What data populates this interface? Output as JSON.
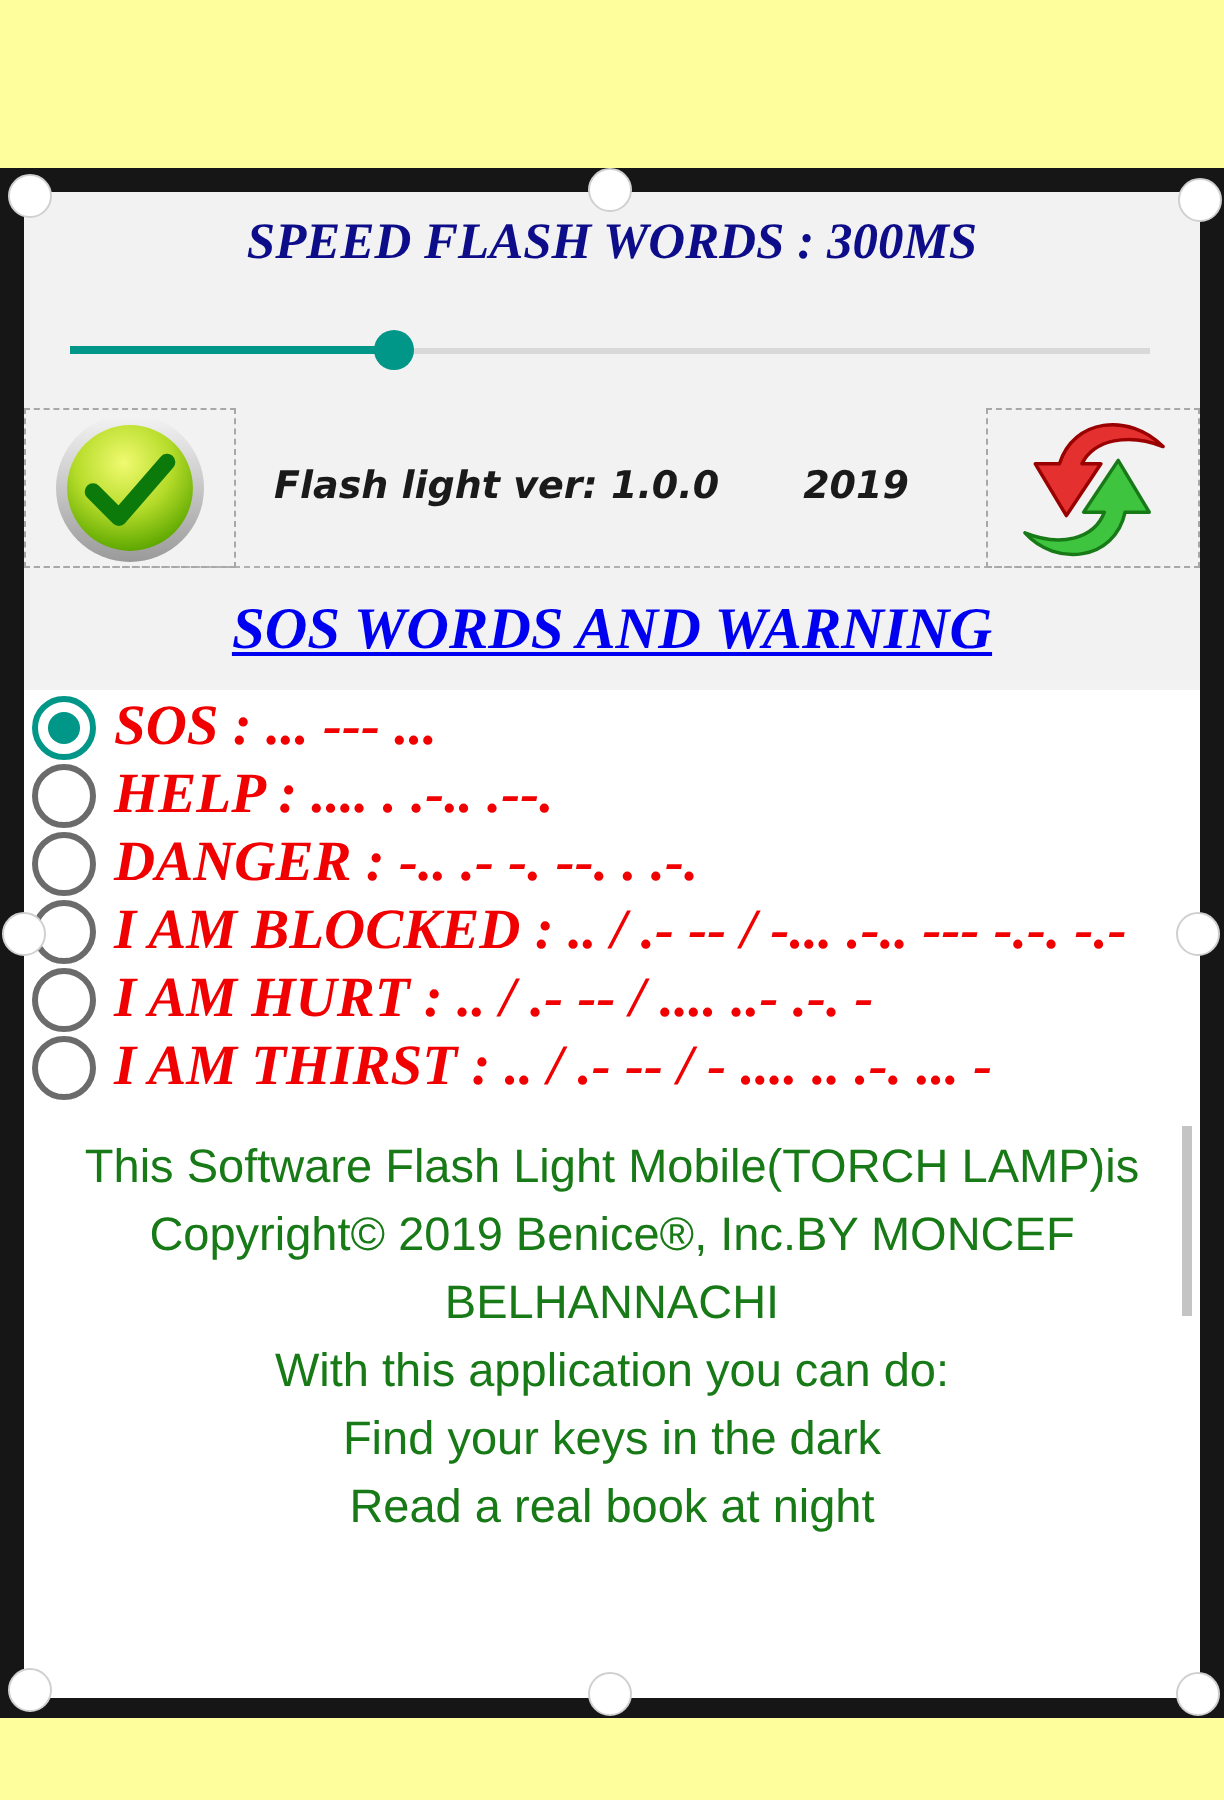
{
  "header": {
    "title": "SPEED FLASH WORDS : 300MS",
    "speed_slider": {
      "level": 0.3
    }
  },
  "info_bar": {
    "version": "Flash light ver: 1.0.0",
    "year": "2019"
  },
  "section_title": "SOS WORDS AND WARNING",
  "sos_options": [
    {
      "label": "SOS : ... --- ...",
      "selected": true
    },
    {
      "label": "HELP : .... . .-.. .--.",
      "selected": false
    },
    {
      "label": "DANGER : -.. .- -. --. . .-.",
      "selected": false
    },
    {
      "label": "I AM BLOCKED : .. / .- -- / -... .-.. --- -.-. -.-",
      "selected": false
    },
    {
      "label": "I AM HURT : .. / .- -- / .... ..- .-. -",
      "selected": false
    },
    {
      "label": "I AM THIRST : .. / .- -- / - .... .. .-. ... -",
      "selected": false
    }
  ],
  "about": {
    "lines": [
      "This Software Flash Light Mobile(TORCH LAMP)is Copyright© 2019 Benice®, Inc.BY MONCEF BELHANNACHI",
      "With this application you can do:",
      "Find your keys in the dark",
      "Read a real book at night"
    ]
  }
}
